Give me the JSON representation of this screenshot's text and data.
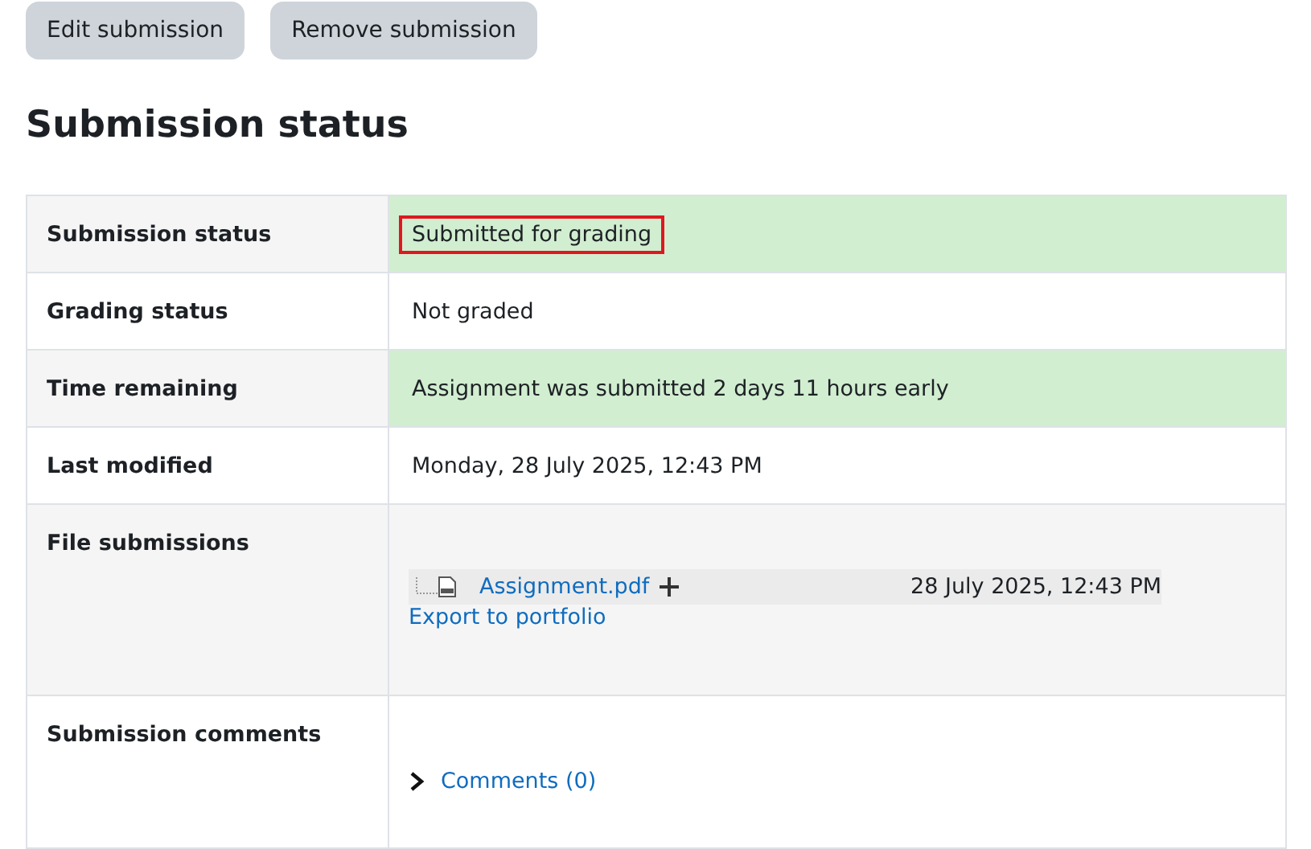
{
  "buttons": [
    "Edit submission",
    "Remove submission"
  ],
  "heading": "Submission status",
  "rows": [
    {
      "kind": "text",
      "label": "Submission status",
      "value": "Submitted for grading",
      "success": true,
      "highlighted": true
    },
    {
      "kind": "text",
      "label": "Grading status",
      "value": "Not graded",
      "success": false,
      "highlighted": false
    },
    {
      "kind": "text",
      "label": "Time remaining",
      "value": "Assignment was submitted 2 days 11 hours early",
      "success": true,
      "highlighted": false
    },
    {
      "kind": "text",
      "label": "Last modified",
      "value": "Monday, 28 July 2025, 12:43 PM",
      "success": false,
      "highlighted": false
    },
    {
      "kind": "files",
      "label": "File submissions",
      "files": [
        {
          "name": "Assignment.pdf",
          "date": "28 July 2025, 12:43 PM"
        }
      ],
      "export_link": "Export to portfolio"
    },
    {
      "kind": "comments",
      "label": "Submission comments",
      "link": "Comments (0)",
      "expanded": false
    }
  ]
}
